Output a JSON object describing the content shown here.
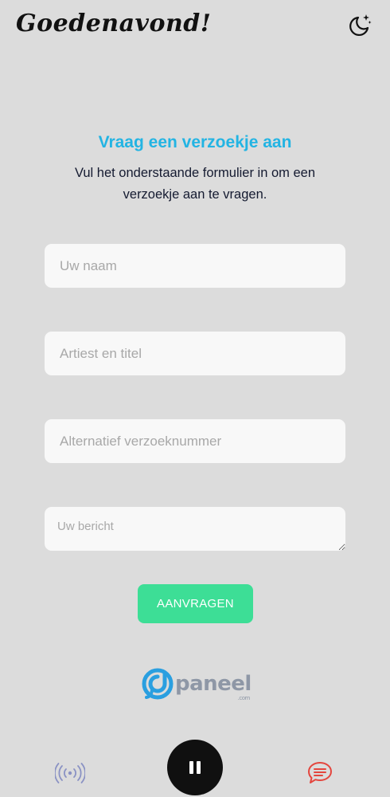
{
  "header": {
    "greeting": "Goedenavond!",
    "theme_icon": "moon-stars-icon"
  },
  "form": {
    "title": "Vraag een verzoekje aan",
    "description": "Vul het onderstaande formulier in om een verzoekje aan te vragen.",
    "name_placeholder": "Uw naam",
    "song_placeholder": "Artiest en titel",
    "alt_placeholder": "Alternatief verzoeknummer",
    "message_placeholder": "Uw bericht",
    "submit_label": "AANVRAGEN"
  },
  "logo": {
    "word": "paneel",
    "suffix": ".com"
  },
  "bottom_nav": {
    "radio_icon": "broadcast-icon",
    "play_state_icon": "pause-icon",
    "chat_icon": "chat-bubble-icon"
  },
  "colors": {
    "accent": "#23b4e3",
    "button": "#3dde96",
    "chat_icon": "#e4453d",
    "logo_blue": "#2a9fe0"
  }
}
